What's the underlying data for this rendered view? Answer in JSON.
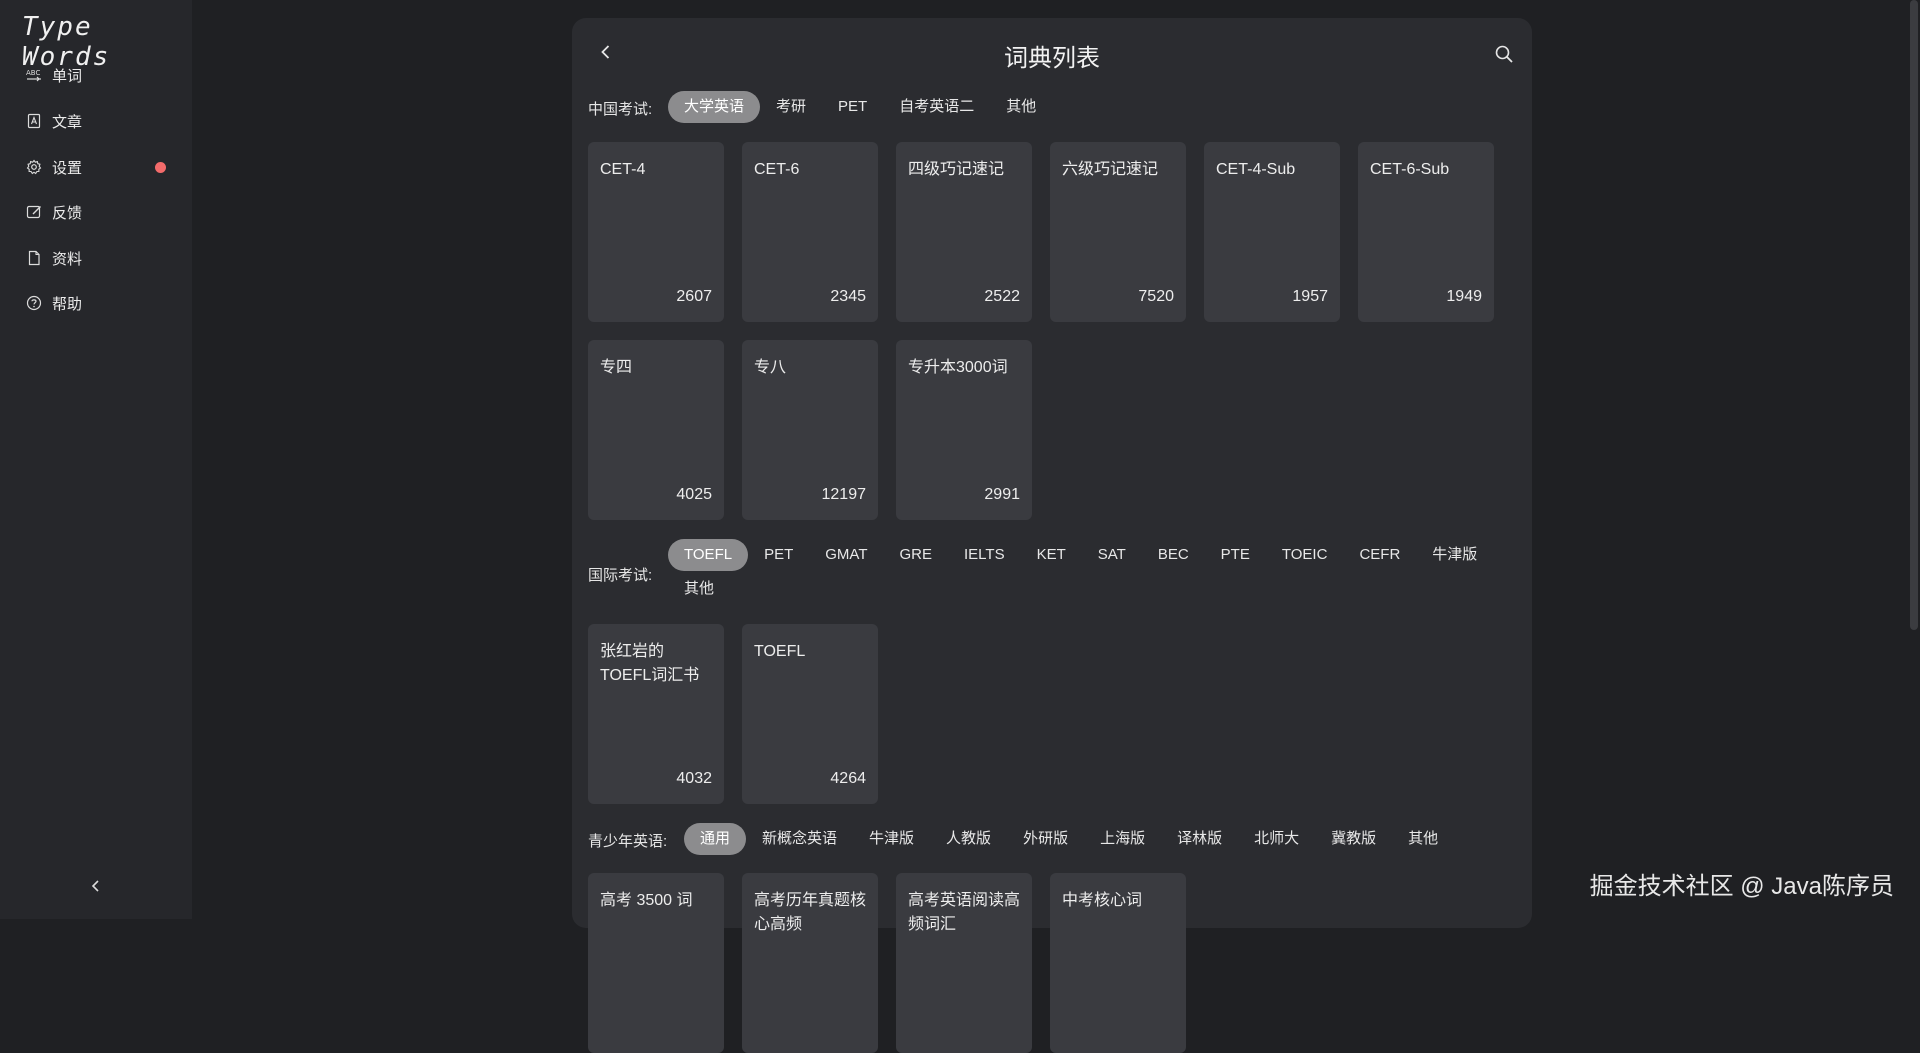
{
  "app": {
    "logo": "Type Words"
  },
  "sidebar": {
    "items": [
      {
        "label": "单词",
        "icon": "abc-icon"
      },
      {
        "label": "文章",
        "icon": "article-icon"
      },
      {
        "label": "设置",
        "icon": "gear-icon",
        "badge": true
      },
      {
        "label": "反馈",
        "icon": "feedback-icon"
      },
      {
        "label": "资料",
        "icon": "file-icon"
      },
      {
        "label": "帮助",
        "icon": "help-icon"
      }
    ],
    "badge_color": "#f36b6b"
  },
  "panel": {
    "title": "词典列表"
  },
  "sections": [
    {
      "label": "中国考试:",
      "tabs": [
        "大学英语",
        "考研",
        "PET",
        "自考英语二",
        "其他"
      ],
      "active": "大学英语",
      "cards": [
        {
          "name": "CET-4",
          "count": "2607"
        },
        {
          "name": "CET-6",
          "count": "2345"
        },
        {
          "name": "四级巧记速记",
          "count": "2522"
        },
        {
          "name": "六级巧记速记",
          "count": "7520"
        },
        {
          "name": "CET-4-Sub",
          "count": "1957"
        },
        {
          "name": "CET-6-Sub",
          "count": "1949"
        },
        {
          "name": "专四",
          "count": "4025"
        },
        {
          "name": "专八",
          "count": "12197"
        },
        {
          "name": "专升本3000词",
          "count": "2991"
        }
      ]
    },
    {
      "label": "国际考试:",
      "tabs": [
        "TOEFL",
        "PET",
        "GMAT",
        "GRE",
        "IELTS",
        "KET",
        "SAT",
        "BEC",
        "PTE",
        "TOEIC",
        "CEFR",
        "牛津版",
        "其他"
      ],
      "active": "TOEFL",
      "cards": [
        {
          "name": "张红岩的TOEFL词汇书",
          "count": "4032"
        },
        {
          "name": "TOEFL",
          "count": "4264"
        }
      ]
    },
    {
      "label": "青少年英语:",
      "tabs": [
        "通用",
        "新概念英语",
        "牛津版",
        "人教版",
        "外研版",
        "上海版",
        "译林版",
        "北师大",
        "冀教版",
        "其他"
      ],
      "active": "通用",
      "cards": [
        {
          "name": "高考 3500 词",
          "count": ""
        },
        {
          "name": "高考历年真题核心高频",
          "count": ""
        },
        {
          "name": "高考英语阅读高频词汇",
          "count": ""
        },
        {
          "name": "中考核心词",
          "count": ""
        }
      ]
    }
  ],
  "watermark": "掘金技术社区 @ Java陈序员",
  "colors": {
    "background": "#1f2023",
    "sidebar": "#26272b",
    "panel": "#2b2c30",
    "card": "#3a3b40",
    "active_tab": "#8c8c8e"
  }
}
